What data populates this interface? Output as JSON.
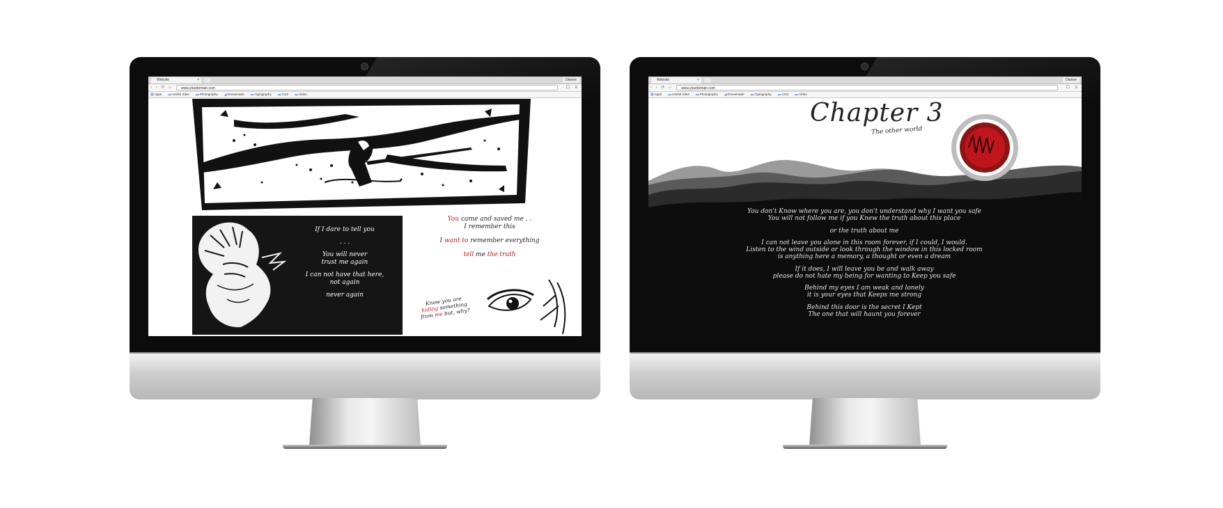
{
  "browser": {
    "tab_title": "Website",
    "tab_close": "×",
    "profile": "Dianne",
    "url": "www.yourdomain.com",
    "nav_icons": "‹ › ⟳ ⌂",
    "right_icons": "☐ ≡",
    "bookmarks": [
      "Apps",
      "Useful Sites",
      "Photography",
      "Grovemade",
      "Typography",
      "CSS",
      "Video"
    ]
  },
  "left_page": {
    "poem": [
      "If I dare to tell you",
      ". . .",
      "You will never",
      "trust me again",
      "I can not have that here,",
      "not again",
      "never again"
    ],
    "right_lines": {
      "l1_red": "You",
      "l1_rest": " came and saved me . .",
      "l2": "I remember this",
      "l3_a": "I ",
      "l3_red": "want to",
      "l3_b": " remember everything",
      "l4_red1": "tell",
      "l4_mid": " me ",
      "l4_red2": "the truth"
    },
    "hiding": {
      "a": "Know you are",
      "b_red": "hiding",
      "b_rest": " something",
      "c_pre": "from ",
      "c_red": "me",
      "c_rest": " but, why?"
    }
  },
  "right_page": {
    "title": "Chapter 3",
    "subtitle": "The other world",
    "story": [
      [
        "You don't Know where you are, you don't understand why I want you safe",
        "You will not follow me if you Knew the truth about this place"
      ],
      [
        "or the truth about me"
      ],
      [
        "I can not leave you alone in this room forever, if I could, I would.",
        "Listen to the wind outside or look through the window in this locked room",
        "is anything here a memory, a thought or even a dream"
      ],
      [
        "If it does, I will leave you be and walk away",
        "please do not hate my being for wanting to Keep you safe"
      ],
      [
        "Behind my eyes I am weak and lonely",
        "it is your eyes that Keeps me strong"
      ],
      [
        "Behind this door is the secret I Kept",
        "The one that will haunt you forever"
      ]
    ]
  },
  "colors": {
    "accent_red": "#c0161b",
    "dark": "#0c0c0c"
  }
}
